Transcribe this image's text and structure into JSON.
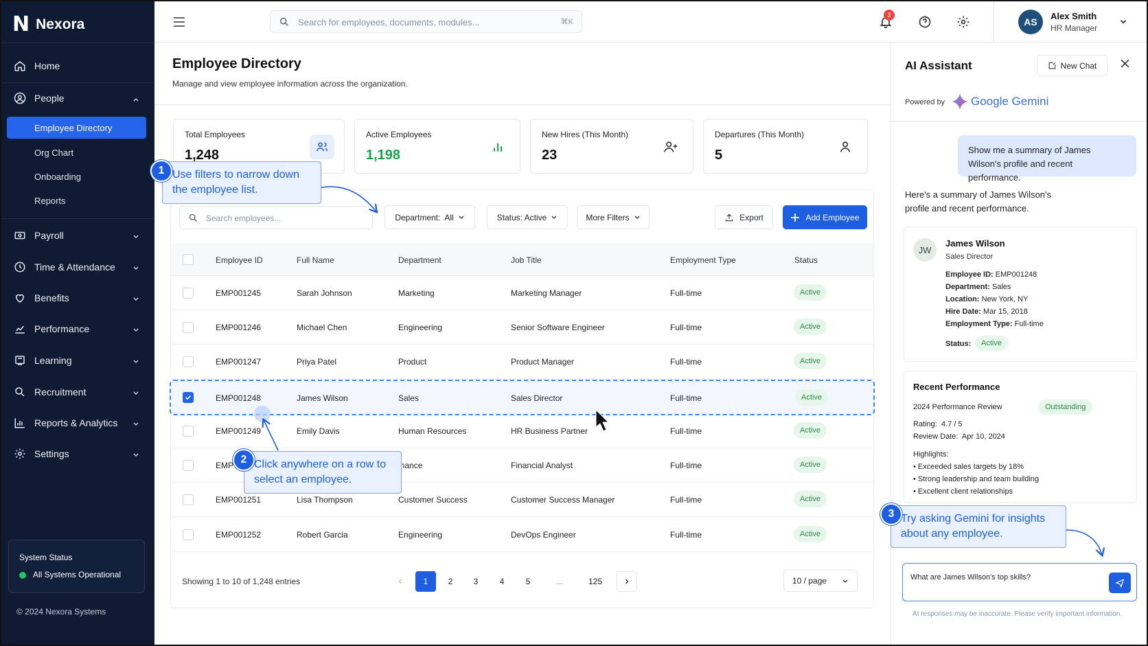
{
  "app": {
    "name": "Nexora",
    "logo_letter": "N"
  },
  "sidebar": {
    "items": [
      {
        "label": "Home",
        "icon": "home-icon"
      },
      {
        "label": "People",
        "icon": "people-icon"
      },
      {
        "label": "Payroll",
        "icon": "payroll-icon"
      },
      {
        "label": "Time & Attendance",
        "icon": "clock-icon"
      },
      {
        "label": "Benefits",
        "icon": "heart-icon"
      },
      {
        "label": "Performance",
        "icon": "chart-icon"
      },
      {
        "label": "Learning",
        "icon": "book-icon"
      },
      {
        "label": "Recruitment",
        "icon": "search-icon"
      },
      {
        "label": "Reports & Analytics",
        "icon": "bar-chart-icon"
      },
      {
        "label": "Settings",
        "icon": "gear-icon"
      }
    ],
    "people_sub": [
      "Employee Directory",
      "Org Chart",
      "Onboarding",
      "Reports"
    ],
    "system_status": {
      "title": "System Status",
      "text": "All Systems Operational"
    },
    "copyright": "© 2024 Nexora Systems"
  },
  "topbar": {
    "search_placeholder": "Search for employees, documents, modules...",
    "shortcut": "⌘K",
    "notification_count": "3",
    "user": {
      "initials": "AS",
      "name": "Alex Smith",
      "role": "HR Manager"
    }
  },
  "page": {
    "title": "Employee Directory",
    "subtitle": "Manage and view employee information across the organization."
  },
  "stats": [
    {
      "label": "Total Employees",
      "value": "1,248"
    },
    {
      "label": "Active Employees",
      "value": "1,198"
    },
    {
      "label": "New Hires (This Month)",
      "value": "23"
    },
    {
      "label": "Departures (This Month)",
      "value": "5"
    }
  ],
  "toolbar": {
    "search_placeholder": "Search employees...",
    "department": "Department:  All",
    "status": "Status: Active",
    "more_filters": "More Filters",
    "export": "Export",
    "add": "Add Employee"
  },
  "table": {
    "headers": [
      "Employee ID",
      "Full Name",
      "Department",
      "Job Title",
      "Employment Type",
      "Status"
    ],
    "rows": [
      [
        "EMP001245",
        "Sarah Johnson",
        "Marketing",
        "Marketing Manager",
        "Full-time",
        "Active"
      ],
      [
        "EMP001246",
        "Michael Chen",
        "Engineering",
        "Senior Software Engineer",
        "Full-time",
        "Active"
      ],
      [
        "EMP001247",
        "Priya Patel",
        "Product",
        "Product Manager",
        "Full-time",
        "Active"
      ],
      [
        "EMP001248",
        "James Wilson",
        "Sales",
        "Sales Director",
        "Full-time",
        "Active"
      ],
      [
        "EMP001249",
        "Emily Davis",
        "Human Resources",
        "HR Business Partner",
        "Full-time",
        "Active"
      ],
      [
        "EMP001250",
        "",
        "Finance",
        "Financial Analyst",
        "Full-time",
        "Active"
      ],
      [
        "EMP001251",
        "Lisa Thompson",
        "Customer Success",
        "Customer Success Manager",
        "Full-time",
        "Active"
      ],
      [
        "EMP001252",
        "Robert Garcia",
        "Engineering",
        "DevOps Engineer",
        "Full-time",
        "Active"
      ]
    ],
    "row5_id_visible": "EMP",
    "row5_dept_visible": "inance",
    "selected_row": 3
  },
  "pagination": {
    "showing": "Showing 1 to 10 of 1,248 entries",
    "pages": [
      "1",
      "2",
      "3",
      "4",
      "5",
      "...",
      "125"
    ],
    "per_page": "10 / page"
  },
  "ai": {
    "title": "AI Assistant",
    "new_chat": "New Chat",
    "powered_by": "Powered by",
    "provider": "Google Gemini",
    "user_message": "Show me a summary of James Wilson's profile and recent performance.",
    "reply": "Here's a summary of James Wilson's profile and recent performance.",
    "profile": {
      "initials": "JW",
      "name": "James Wilson",
      "role": "Sales Director",
      "fields": [
        {
          "k": "Employee ID:",
          "v": "EMP001248"
        },
        {
          "k": "Department:",
          "v": "Sales"
        },
        {
          "k": "Location:",
          "v": "New York, NY"
        },
        {
          "k": "Hire Date:",
          "v": "Mar 15, 2018"
        },
        {
          "k": "Employment Type:",
          "v": "Full-time"
        }
      ],
      "status_label": "Status:",
      "status": "Active"
    },
    "performance": {
      "title": "Recent Performance",
      "review": "2024 Performance Review",
      "badge": "Outstanding",
      "rating": "Rating:  4.7 / 5",
      "review_date": "Review Date:  Apr 10, 2024",
      "highlights_title": "Highlights:",
      "highlights": [
        "Exceeded sales targets by 18%",
        "Strong leadership and team building",
        "Excellent client relationships"
      ]
    },
    "input_value": "What are James Wilson's top skills?",
    "disclaimer": "AI responses may be inaccurate. Please verify important information."
  },
  "callouts": [
    {
      "num": "1",
      "text": "Use filters to narrow down the employee list."
    },
    {
      "num": "2",
      "text": "Click anywhere on a row to select an employee."
    },
    {
      "num": "3",
      "text": "Try asking Gemini for insights about any employee."
    }
  ]
}
